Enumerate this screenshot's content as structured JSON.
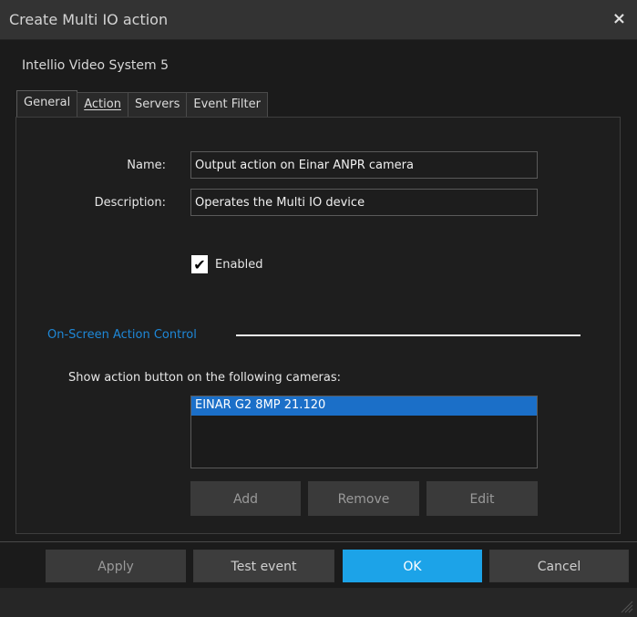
{
  "window": {
    "title": "Create Multi IO action",
    "close_glyph": "×"
  },
  "app_name": "Intellio Video System 5",
  "tabs": [
    {
      "label": "General",
      "active": true
    },
    {
      "label": "Action",
      "active": false
    },
    {
      "label": "Servers",
      "active": false
    },
    {
      "label": "Event Filter",
      "active": false
    }
  ],
  "form": {
    "name_label": "Name:",
    "name_value": "Output action on Einar ANPR camera",
    "description_label": "Description:",
    "description_value": "Operates the Multi IO device",
    "enabled_label": "Enabled",
    "enabled_checked": true,
    "check_glyph": "✔"
  },
  "onscreen": {
    "section_title": "On-Screen Action Control",
    "list_label": "Show action button on the following cameras:",
    "cameras": [
      "EINAR G2 8MP 21.120"
    ],
    "add_label": "Add",
    "remove_label": "Remove",
    "edit_label": "Edit"
  },
  "footer": {
    "apply_label": "Apply",
    "test_label": "Test event",
    "ok_label": "OK",
    "cancel_label": "Cancel"
  },
  "colors": {
    "accent": "#1ca3e8",
    "selection": "#1b6fc8",
    "section_title": "#1e88d8",
    "background": "#1b1b1b"
  }
}
